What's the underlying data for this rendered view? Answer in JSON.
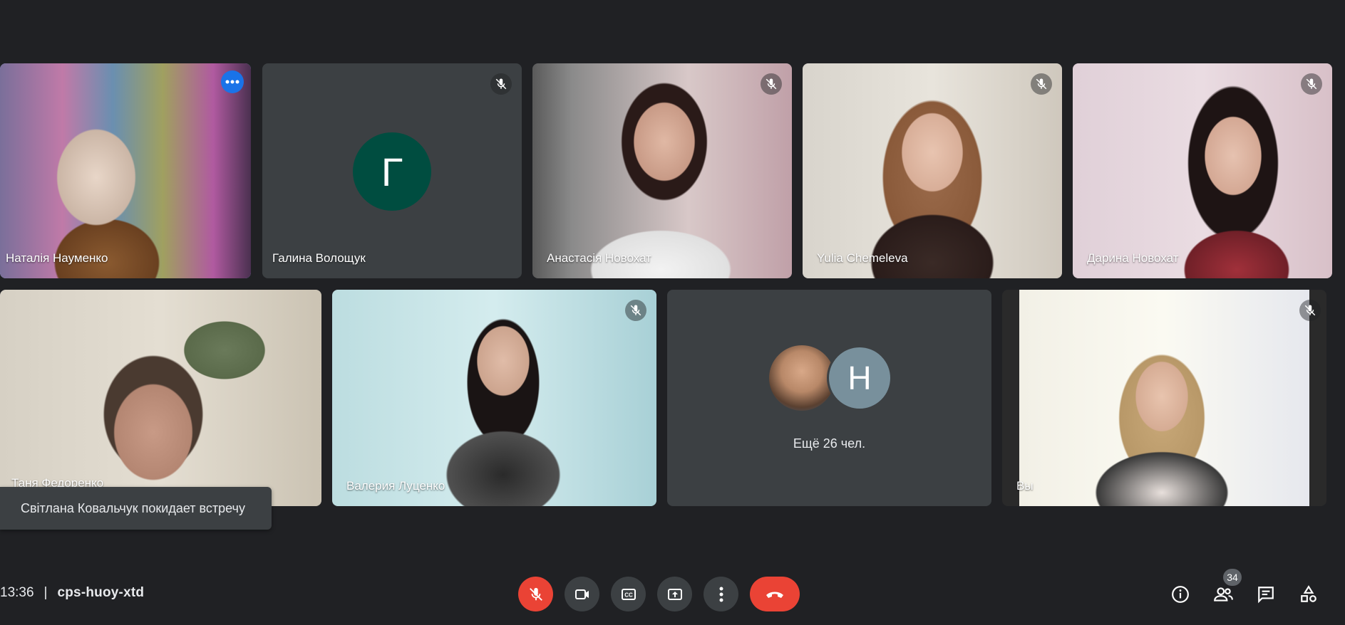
{
  "toast": {
    "message": "Світлана Ковальчук покидает встречу"
  },
  "meeting": {
    "time": "13:36",
    "separator": "|",
    "code": "cps-huoy-xtd"
  },
  "participants_count": "34",
  "tiles": [
    {
      "name": "Наталія Науменко",
      "muted": false
    },
    {
      "name": "Галина Волощук",
      "initial": "Г",
      "muted": true
    },
    {
      "name": "Анастасія Новохат",
      "muted": true
    },
    {
      "name": "Yulia Chemeleva",
      "muted": true
    },
    {
      "name": "Дарина Новохат",
      "muted": true
    },
    {
      "name": "Таня Федоренко",
      "muted": false
    },
    {
      "name": "Валерия Луценко",
      "muted": true
    },
    {
      "name": "",
      "more_label": "Ещё 26 чел.",
      "initial": "Н"
    },
    {
      "name": "Вы",
      "muted": true
    }
  ],
  "controls": [
    "mic-off",
    "camera",
    "captions",
    "present",
    "more-options",
    "leave-call"
  ],
  "right_controls": [
    "meeting-details",
    "people",
    "chat",
    "activities"
  ],
  "colors": {
    "background": "#202124",
    "tile": "#3c4043",
    "red": "#ea4335",
    "blue": "#1a73e8",
    "green_avatar": "#004d40",
    "grey_avatar": "#78909c"
  }
}
